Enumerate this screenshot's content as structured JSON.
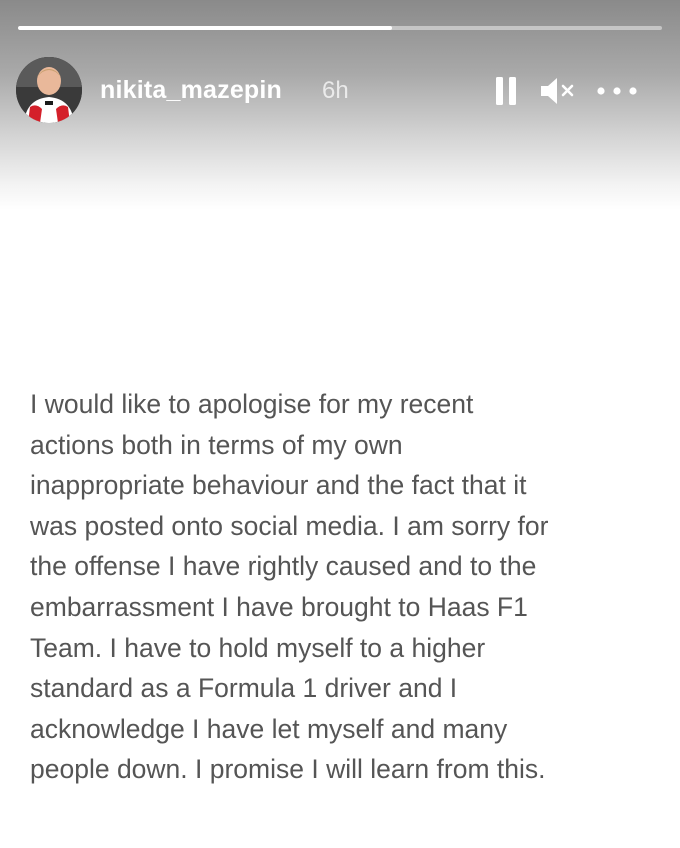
{
  "story": {
    "username": "nikita_mazepin",
    "timestamp": "6h",
    "progress": 0.58,
    "avatar_icon": "profile-photo",
    "controls": {
      "pause_icon": "pause-icon",
      "mute_icon": "muted-speaker-icon",
      "more_icon": "more-options-icon"
    },
    "text_color": "#555555",
    "header_color": "#ffffff"
  },
  "message": {
    "lines": [
      "I would like to apologise for my recent",
      "actions both in terms of my own",
      "inappropriate behaviour and the fact that it",
      "was posted onto social media. I am sorry for",
      "the offense I have rightly caused and to the",
      "embarrassment I have brought to Haas F1",
      "Team. I have to hold myself to a higher",
      "standard as a Formula 1 driver and I",
      "acknowledge I have let myself and many",
      "people down. I promise I will learn from this."
    ]
  }
}
